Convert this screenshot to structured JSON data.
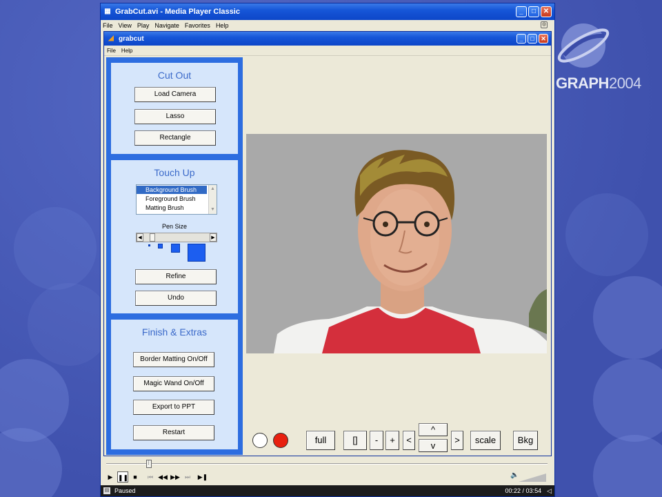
{
  "brand": {
    "logo_text_bold": "GRAPH",
    "logo_text_year": "2004",
    "logo_color": "#9aa7e0"
  },
  "window": {
    "title": "GrabCut.avi - Media Player Classic",
    "menu": [
      "File",
      "View",
      "Play",
      "Navigate",
      "Favorites",
      "Help"
    ],
    "min": "_",
    "max": "□",
    "close": "✕"
  },
  "app": {
    "title": "grabcut",
    "menu": [
      "File",
      "Help"
    ],
    "min": "_",
    "max": "□",
    "close": "✕"
  },
  "cut_out": {
    "title": "Cut Out",
    "buttons": [
      "Load Camera",
      "Lasso",
      "Rectangle"
    ]
  },
  "touch_up": {
    "title": "Touch Up",
    "brushes": [
      "Background Brush",
      "Foreground Brush",
      "Matting Brush"
    ],
    "selected_brush": "Background Brush",
    "pen_size_label": "Pen Size",
    "pen_size_level": 0.1,
    "buttons": [
      "Refine",
      "Undo"
    ]
  },
  "finish": {
    "title": "Finish & Extras",
    "buttons": [
      "Border Matting On/Off",
      "Magic Wand On/Off",
      "Export to PPT",
      "Restart"
    ]
  },
  "view_controls": {
    "full": "full",
    "brackets": "[]",
    "minus": "-",
    "plus": "+",
    "left": "<",
    "up": "^",
    "down": "v",
    "right": ">",
    "scale": "scale",
    "bkg": "Bkg",
    "colors": {
      "white": "#ffffff",
      "red": "#e8200f"
    }
  },
  "player": {
    "status": "Paused",
    "time": "00:22 / 03:54",
    "position": 0.09
  }
}
